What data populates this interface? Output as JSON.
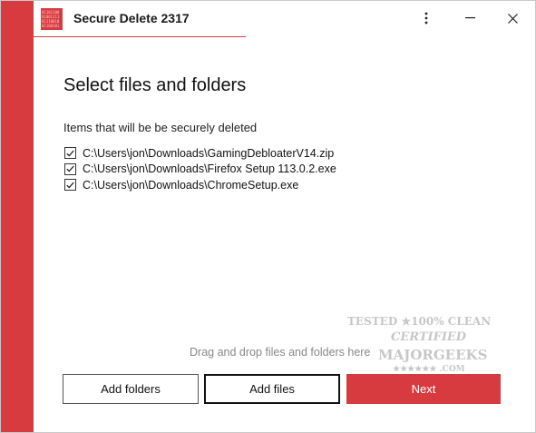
{
  "window": {
    "title": "Secure Delete 2317",
    "logo_text": "01101100\n01001111\n01110010\n01100101",
    "controls": {
      "more_icon": "more-vertical-icon",
      "minimize_icon": "minimize-icon",
      "close_icon": "close-icon"
    }
  },
  "main": {
    "heading": "Select files and folders",
    "subheading": "Items that will be be securely deleted",
    "files": [
      {
        "path": "C:\\Users\\jon\\Downloads\\GamingDebloaterV14.zip",
        "checked": true
      },
      {
        "path": "C:\\Users\\jon\\Downloads\\Firefox Setup 113.0.2.exe",
        "checked": true
      },
      {
        "path": "C:\\Users\\jon\\Downloads\\ChromeSetup.exe",
        "checked": true
      }
    ],
    "drop_hint": "Drag and drop files and folders here"
  },
  "buttons": {
    "add_folders": "Add folders",
    "add_files": "Add files",
    "next": "Next"
  },
  "watermark": {
    "line1": "TESTED ★100% CLEAN",
    "line2": "CERTIFIED",
    "line3": "MAJORGEEKS",
    "line4": "★★★★★★ .COM"
  },
  "colors": {
    "accent": "#d83b3f",
    "hint_text": "#888888"
  }
}
